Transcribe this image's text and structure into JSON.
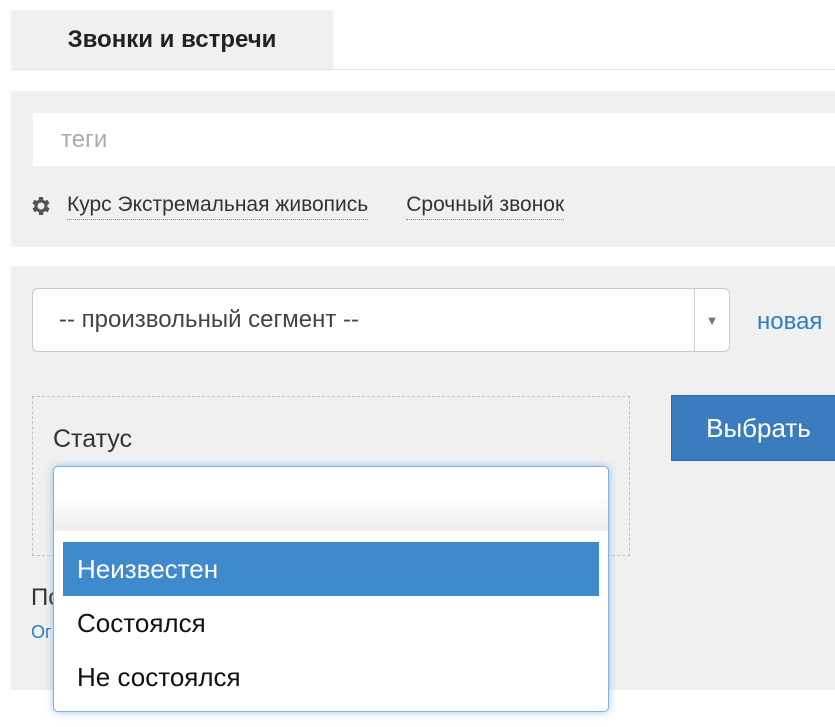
{
  "tabs": [
    {
      "label": "Звонки и встречи",
      "active": true
    }
  ],
  "tags": {
    "placeholder": "теги",
    "items": [
      {
        "label": "Курс Экстремальная живопись"
      },
      {
        "label": "Срочный звонок"
      }
    ]
  },
  "filter": {
    "segment": {
      "value": "-- произвольный сегмент --"
    },
    "new_link": "новая",
    "condition": {
      "label": "Статус"
    },
    "apply_button": "Выбрать",
    "below_text": "По",
    "below_link": "Ог"
  },
  "status_dropdown": {
    "options": [
      {
        "label": "Неизвестен",
        "highlighted": true
      },
      {
        "label": "Состоялся",
        "highlighted": false
      },
      {
        "label": "Не состоялся",
        "highlighted": false
      }
    ]
  },
  "colors": {
    "accent": "#3b7cbf",
    "link": "#2e7cc2",
    "highlight": "#3e8acd",
    "panel": "#f0f0f0"
  }
}
